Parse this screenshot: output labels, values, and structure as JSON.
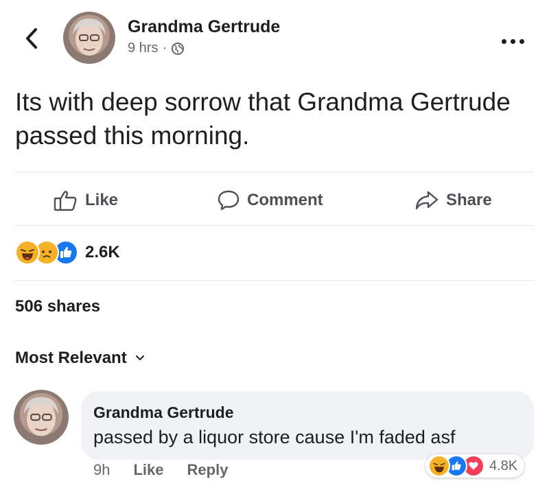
{
  "colors": {
    "like_blue": "#1877f2",
    "love_red": "#f33e58",
    "haha_yellow": "#f7b125",
    "secondary_text": "#65676b"
  },
  "post": {
    "author": "Grandma Gertrude",
    "time": "9 hrs",
    "separator": "·",
    "privacy_icon": "globe-icon",
    "text": "Its with deep sorrow that Grandma Gertrude passed this morning."
  },
  "actions": {
    "like": "Like",
    "comment": "Comment",
    "share": "Share"
  },
  "reactions": {
    "icons": [
      "haha-reaction-icon",
      "sad-reaction-icon",
      "like-reaction-icon"
    ],
    "count": "2.6K"
  },
  "shares_text": "506 shares",
  "sort_label": "Most Relevant",
  "comment": {
    "author": "Grandma Gertrude",
    "text": "passed by a liquor store cause I'm faded asf",
    "time": "9h",
    "like": "Like",
    "reply": "Reply",
    "reaction_icons": [
      "haha-reaction-icon",
      "like-reaction-icon",
      "love-reaction-icon"
    ],
    "reaction_count": "4.8K"
  }
}
